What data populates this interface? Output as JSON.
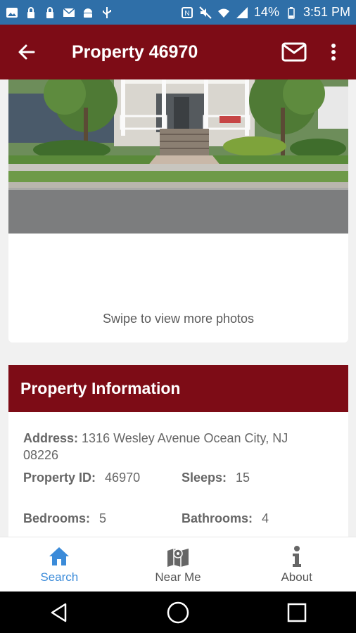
{
  "status_bar": {
    "battery": "14%",
    "time": "3:51 PM",
    "left_icons": [
      "image-icon",
      "lock-icon",
      "lock-icon",
      "mail-icon",
      "android-icon",
      "usb-icon"
    ],
    "right_icons": [
      "nfc-icon",
      "mute-icon",
      "wifi-icon",
      "signal-icon",
      "battery-icon"
    ]
  },
  "app_bar": {
    "title": "Property 46970",
    "color": "#7d0c16"
  },
  "photo": {
    "swipe_hint": "Swipe to view more photos"
  },
  "info": {
    "header": "Property Information",
    "address_label": "Address:",
    "address_value": "1316 Wesley Avenue Ocean City, NJ 08226",
    "property_id_label": "Property ID:",
    "property_id_value": "46970",
    "sleeps_label": "Sleeps:",
    "sleeps_value": "15",
    "bedrooms_label": "Bedrooms:",
    "bedrooms_value": "5",
    "bathrooms_label": "Bathrooms:",
    "bathrooms_value": "4"
  },
  "bottom_nav": {
    "items": [
      {
        "label": "Search",
        "icon": "home-icon",
        "active": true
      },
      {
        "label": "Near Me",
        "icon": "map-icon",
        "active": false
      },
      {
        "label": "About",
        "icon": "info-icon",
        "active": false
      }
    ],
    "active_color": "#3b8bd9"
  }
}
